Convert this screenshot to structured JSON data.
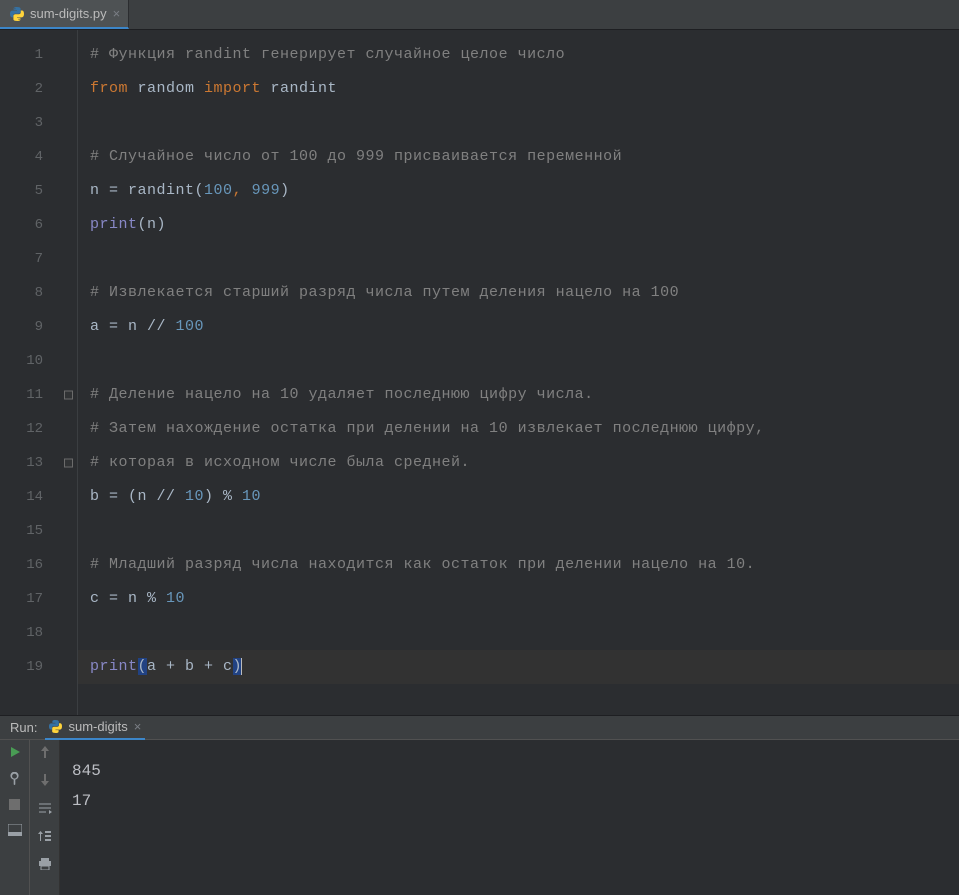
{
  "tab": {
    "filename": "sum-digits.py"
  },
  "code": {
    "lines": [
      {
        "n": 1,
        "tokens": [
          {
            "c": "t-comment",
            "t": "# Функция randint генерирует случайное целое число"
          }
        ]
      },
      {
        "n": 2,
        "tokens": [
          {
            "c": "t-kw",
            "t": "from"
          },
          {
            "c": "t-ident",
            "t": " random "
          },
          {
            "c": "t-kw",
            "t": "import"
          },
          {
            "c": "t-ident",
            "t": " randint"
          }
        ]
      },
      {
        "n": 3,
        "tokens": []
      },
      {
        "n": 4,
        "tokens": [
          {
            "c": "t-comment",
            "t": "# Случайное число от 100 до 999 присваивается переменной"
          }
        ]
      },
      {
        "n": 5,
        "tokens": [
          {
            "c": "t-ident",
            "t": "n = "
          },
          {
            "c": "t-ident",
            "t": "randint"
          },
          {
            "c": "t-paren",
            "t": "("
          },
          {
            "c": "t-num",
            "t": "100"
          },
          {
            "c": "t-comma",
            "t": ", "
          },
          {
            "c": "t-num",
            "t": "999"
          },
          {
            "c": "t-paren",
            "t": ")"
          }
        ]
      },
      {
        "n": 6,
        "tokens": [
          {
            "c": "t-func",
            "t": "print"
          },
          {
            "c": "t-paren",
            "t": "("
          },
          {
            "c": "t-ident",
            "t": "n"
          },
          {
            "c": "t-paren",
            "t": ")"
          }
        ]
      },
      {
        "n": 7,
        "tokens": []
      },
      {
        "n": 8,
        "tokens": [
          {
            "c": "t-comment",
            "t": "# Извлекается старший разряд числа путем деления нацело на 100"
          }
        ]
      },
      {
        "n": 9,
        "tokens": [
          {
            "c": "t-ident",
            "t": "a = n // "
          },
          {
            "c": "t-num",
            "t": "100"
          }
        ]
      },
      {
        "n": 10,
        "tokens": []
      },
      {
        "n": 11,
        "fold": true,
        "tokens": [
          {
            "c": "t-comment",
            "t": "# Деление нацело на 10 удаляет последнюю цифру числа."
          }
        ]
      },
      {
        "n": 12,
        "tokens": [
          {
            "c": "t-comment",
            "t": "# Затем нахождение остатка при делении на 10 извлекает последнюю цифру,"
          }
        ]
      },
      {
        "n": 13,
        "fold": true,
        "tokens": [
          {
            "c": "t-comment",
            "t": "# которая в исходном числе была средней."
          }
        ]
      },
      {
        "n": 14,
        "tokens": [
          {
            "c": "t-ident",
            "t": "b = (n // "
          },
          {
            "c": "t-num",
            "t": "10"
          },
          {
            "c": "t-ident",
            "t": ") % "
          },
          {
            "c": "t-num",
            "t": "10"
          }
        ]
      },
      {
        "n": 15,
        "tokens": []
      },
      {
        "n": 16,
        "tokens": [
          {
            "c": "t-comment",
            "t": "# Младший разряд числа находится как остаток при делении нацело на 10."
          }
        ]
      },
      {
        "n": 17,
        "tokens": [
          {
            "c": "t-ident",
            "t": "c = n % "
          },
          {
            "c": "t-num",
            "t": "10"
          }
        ]
      },
      {
        "n": 18,
        "tokens": []
      },
      {
        "n": 19,
        "active": true,
        "tokens": [
          {
            "c": "t-func",
            "t": "print"
          },
          {
            "c": "t-paren t-caretbg",
            "t": "("
          },
          {
            "c": "t-ident",
            "t": "a + b + c"
          },
          {
            "c": "t-paren t-caretbg",
            "t": ")"
          }
        ]
      }
    ]
  },
  "run": {
    "label": "Run:",
    "config": "sum-digits",
    "output": [
      "845",
      "17"
    ]
  },
  "icons": {
    "play": "play-icon",
    "wrench": "wrench-icon",
    "stop": "stop-icon",
    "layout": "layout-icon",
    "up": "up-arrow-icon",
    "down": "down-arrow-icon",
    "softwrap": "softwrap-icon",
    "scroll": "scroll-to-end-icon",
    "print": "print-icon"
  }
}
